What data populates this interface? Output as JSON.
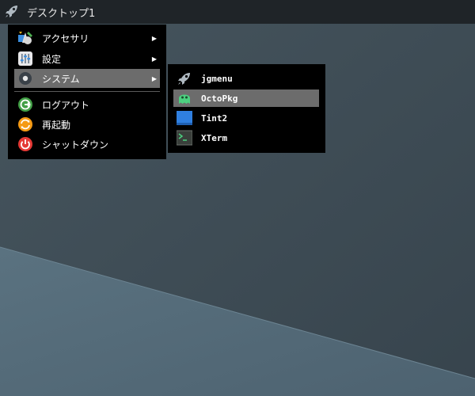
{
  "panel": {
    "title": "デスクトップ1",
    "launcher_icon": "rocket-icon"
  },
  "main_menu": {
    "items": [
      {
        "label": "アクセサリ",
        "icon": "accessories-icon",
        "submenu": true,
        "arrow": "▶"
      },
      {
        "label": "設定",
        "icon": "settings-icon",
        "submenu": true,
        "arrow": "▶"
      },
      {
        "label": "システム",
        "icon": "system-icon",
        "submenu": true,
        "arrow": "▶",
        "selected": true
      },
      {
        "label": "ログアウト",
        "icon": "logout-icon"
      },
      {
        "label": "再起動",
        "icon": "restart-icon"
      },
      {
        "label": "シャットダウン",
        "icon": "shutdown-icon"
      }
    ]
  },
  "system_submenu": {
    "items": [
      {
        "label": "jgmenu",
        "icon": "rocket-icon"
      },
      {
        "label": "OctoPkg",
        "icon": "octopkg-icon",
        "selected": true
      },
      {
        "label": "Tint2",
        "icon": "tint2-icon"
      },
      {
        "label": "XTerm",
        "icon": "terminal-icon"
      }
    ]
  },
  "colors": {
    "panel_bg": "#1f2428",
    "menu_bg": "#000000",
    "selection_bg": "#6c6c6c",
    "desktop_top": "#3e4c55",
    "desktop_bottom": "#566d7a",
    "logout_green": "#43a047",
    "restart_orange": "#f59a14",
    "shutdown_red": "#e53935"
  }
}
